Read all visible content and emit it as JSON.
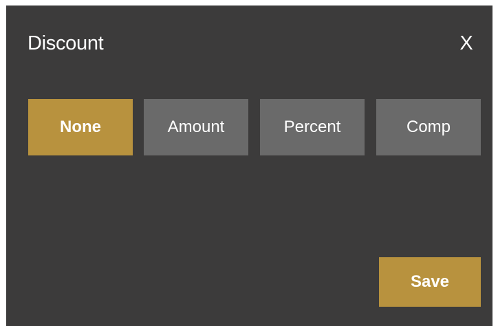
{
  "dialog": {
    "title": "Discount",
    "close_label": "X"
  },
  "discount_types": [
    {
      "label": "None",
      "selected": true
    },
    {
      "label": "Amount",
      "selected": false
    },
    {
      "label": "Percent",
      "selected": false
    },
    {
      "label": "Comp",
      "selected": false
    }
  ],
  "actions": {
    "save_label": "Save"
  },
  "colors": {
    "background": "#3c3b3b",
    "accent": "#b8923e",
    "unselected_button": "#6a6a6a",
    "text": "#ffffff"
  }
}
